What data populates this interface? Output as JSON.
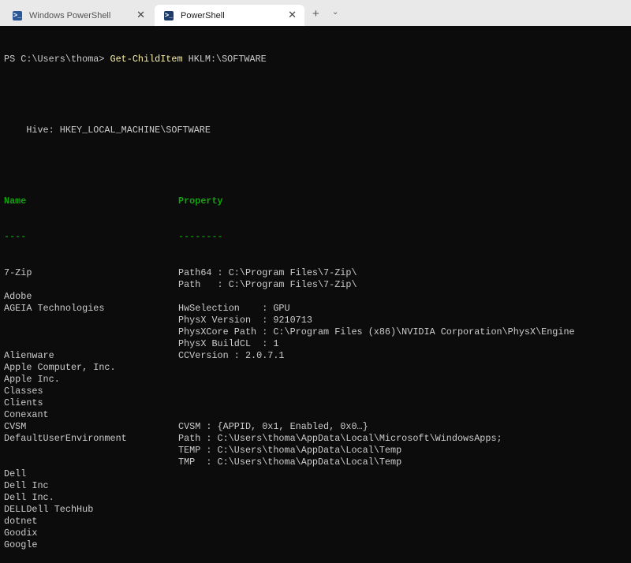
{
  "tabs": [
    {
      "label": "Windows PowerShell",
      "active": false
    },
    {
      "label": "PowerShell",
      "active": true
    }
  ],
  "tab_icons": {
    "ps": ">_",
    "close": "✕",
    "new": "+",
    "dropdown": "⌄"
  },
  "colors": {
    "background": "#0c0c0c",
    "text": "#cccccc",
    "header": "#13a10e",
    "command": "#f9f1a5"
  },
  "prompt": {
    "path": "PS C:\\Users\\thoma> ",
    "command": "Get-ChildItem",
    "argument": " HKLM:\\SOFTWARE"
  },
  "hive": "    Hive: HKEY_LOCAL_MACHINE\\SOFTWARE",
  "headers": {
    "name": "Name",
    "property": "Property",
    "name_underline": "----",
    "property_underline": "--------"
  },
  "rows": [
    {
      "name": "7-Zip",
      "property": "Path64 : C:\\Program Files\\7-Zip\\"
    },
    {
      "name": "",
      "property": "Path   : C:\\Program Files\\7-Zip\\"
    },
    {
      "name": "Adobe",
      "property": ""
    },
    {
      "name": "AGEIA Technologies",
      "property": "HwSelection    : GPU"
    },
    {
      "name": "",
      "property": "PhysX Version  : 9210713"
    },
    {
      "name": "",
      "property": "PhysXCore Path : C:\\Program Files (x86)\\NVIDIA Corporation\\PhysX\\Engine"
    },
    {
      "name": "",
      "property": "PhysX BuildCL  : 1"
    },
    {
      "name": "Alienware",
      "property": "CCVersion : 2.0.7.1"
    },
    {
      "name": "Apple Computer, Inc.",
      "property": ""
    },
    {
      "name": "Apple Inc.",
      "property": ""
    },
    {
      "name": "Classes",
      "property": ""
    },
    {
      "name": "Clients",
      "property": ""
    },
    {
      "name": "Conexant",
      "property": ""
    },
    {
      "name": "CVSM",
      "property": "CVSM : {APPID, 0x1, Enabled, 0x0…}"
    },
    {
      "name": "DefaultUserEnvironment",
      "property": "Path : C:\\Users\\thoma\\AppData\\Local\\Microsoft\\WindowsApps;"
    },
    {
      "name": "",
      "property": "TEMP : C:\\Users\\thoma\\AppData\\Local\\Temp"
    },
    {
      "name": "",
      "property": "TMP  : C:\\Users\\thoma\\AppData\\Local\\Temp"
    },
    {
      "name": "Dell",
      "property": ""
    },
    {
      "name": "Dell Inc",
      "property": ""
    },
    {
      "name": "Dell Inc.",
      "property": ""
    },
    {
      "name": "DELLDell TechHub",
      "property": ""
    },
    {
      "name": "dotnet",
      "property": ""
    },
    {
      "name": "Goodix",
      "property": ""
    },
    {
      "name": "Google",
      "property": ""
    }
  ]
}
